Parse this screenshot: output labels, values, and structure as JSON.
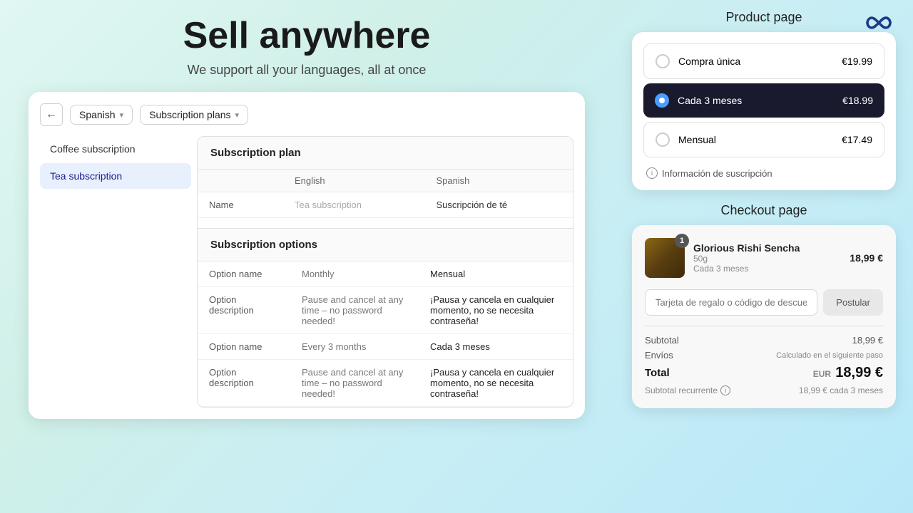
{
  "logo": {
    "alt": "Infinity logo"
  },
  "hero": {
    "title": "Sell anywhere",
    "subtitle": "We support all your languages, all at once"
  },
  "toolbar": {
    "back_label": "←",
    "language_label": "Spanish",
    "dropdown_label": "Subscription plans"
  },
  "sidebar": {
    "items": [
      {
        "label": "Coffee subscription",
        "active": false
      },
      {
        "label": "Tea subscription",
        "active": true
      }
    ]
  },
  "subscription_plan": {
    "section_title": "Subscription plan",
    "columns": {
      "key": "",
      "english": "English",
      "spanish": "Spanish"
    },
    "rows": [
      {
        "key": "Name",
        "english": "Tea subscription",
        "spanish": "Suscripción de té"
      }
    ]
  },
  "subscription_options": {
    "section_title": "Subscription options",
    "rows": [
      {
        "key": "Option name",
        "english": "Monthly",
        "spanish": "Mensual"
      },
      {
        "key": "Option description",
        "english": "Pause and cancel at any time – no password needed!",
        "spanish": "¡Pausa y cancela en cualquier momento, no se necesita contraseña!"
      },
      {
        "key": "Option name",
        "english": "Every 3 months",
        "spanish": "Cada 3 meses"
      },
      {
        "key": "Option description",
        "english": "Pause and cancel at any time – no password needed!",
        "spanish": "¡Pausa y cancela en cualquier momento, no se necesita contraseña!"
      }
    ]
  },
  "product_page": {
    "label": "Product page",
    "options": [
      {
        "label": "Compra única",
        "price": "€19.99",
        "selected": false
      },
      {
        "label": "Cada 3 meses",
        "price": "€18.99",
        "selected": true
      },
      {
        "label": "Mensual",
        "price": "€17.49",
        "selected": false
      }
    ],
    "subscription_info_label": "Información de suscripción"
  },
  "checkout_page": {
    "label": "Checkout page",
    "item": {
      "name": "Glorious Rishi Sencha",
      "variant": "50g",
      "subscription": "Cada 3 meses",
      "price": "18,99 €",
      "badge": "1"
    },
    "discount": {
      "placeholder": "Tarjeta de regalo o código de descuento",
      "button_label": "Postular"
    },
    "totals": [
      {
        "label": "Subtotal",
        "value": "18,99 €",
        "bold": false
      },
      {
        "label": "Envíos",
        "value": "Calculado en el siguiente paso",
        "bold": false
      },
      {
        "label": "Total",
        "currency": "EUR",
        "value": "18,99 €",
        "bold": true
      }
    ],
    "subtotal_recurrente": {
      "label": "Subtotal recurrente",
      "value": "18,99 € cada 3 meses"
    }
  }
}
